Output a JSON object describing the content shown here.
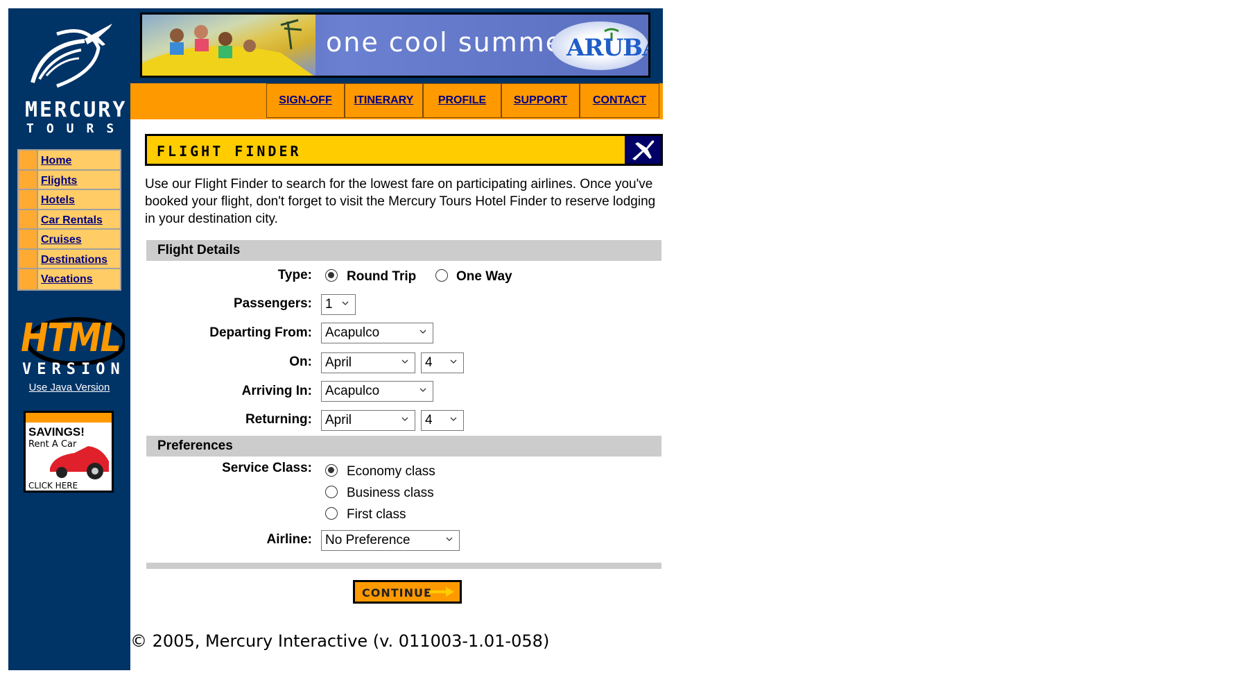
{
  "brand": {
    "name": "MERCURY",
    "sub": "TOURS"
  },
  "side_nav": {
    "items": [
      {
        "label": "Home"
      },
      {
        "label": "Flights"
      },
      {
        "label": "Hotels"
      },
      {
        "label": "Car Rentals"
      },
      {
        "label": "Cruises"
      },
      {
        "label": "Destinations"
      },
      {
        "label": "Vacations"
      }
    ]
  },
  "version_badge": {
    "html": "HTML",
    "version": "VERSION",
    "java_link": "Use Java Version"
  },
  "ad": {
    "title": "SAVINGS!",
    "subtitle": "Rent A Car",
    "cta": "CLICK HERE"
  },
  "banner": {
    "text": "one cool summer",
    "brand": "ARUBA"
  },
  "top_nav": {
    "items": [
      {
        "label": "SIGN-OFF"
      },
      {
        "label": "ITINERARY"
      },
      {
        "label": "PROFILE"
      },
      {
        "label": "SUPPORT"
      },
      {
        "label": "CONTACT"
      }
    ]
  },
  "finder": {
    "title": "FLIGHT FINDER",
    "intro": "Use our Flight Finder to search for the lowest fare on participating airlines. Once you've booked your flight, don't forget to visit the Mercury Tours Hotel Finder to reserve lodging in your destination city."
  },
  "flight_details": {
    "heading": "Flight Details",
    "type_label": "Type:",
    "type_options": [
      "Round Trip",
      "One Way"
    ],
    "type_selected": "Round Trip",
    "passengers_label": "Passengers:",
    "passengers_value": "1",
    "departing_label": "Departing From:",
    "departing_value": "Acapulco",
    "on_label": "On:",
    "on_month": "April",
    "on_day": "4",
    "arriving_label": "Arriving In:",
    "arriving_value": "Acapulco",
    "returning_label": "Returning:",
    "returning_month": "April",
    "returning_day": "4"
  },
  "preferences": {
    "heading": "Preferences",
    "class_label": "Service Class:",
    "class_options": [
      "Economy class",
      "Business class",
      "First class"
    ],
    "class_selected": "Economy class",
    "airline_label": "Airline:",
    "airline_value": "No Preference"
  },
  "continue_label": "CONTINUE",
  "footer": "© 2005, Mercury Interactive (v. 011003-1.01-058)",
  "colors": {
    "navy": "#003366",
    "orange": "#ff9900",
    "yellow": "#ffcc00",
    "link": "#000080",
    "section_gray": "#cccccc"
  }
}
